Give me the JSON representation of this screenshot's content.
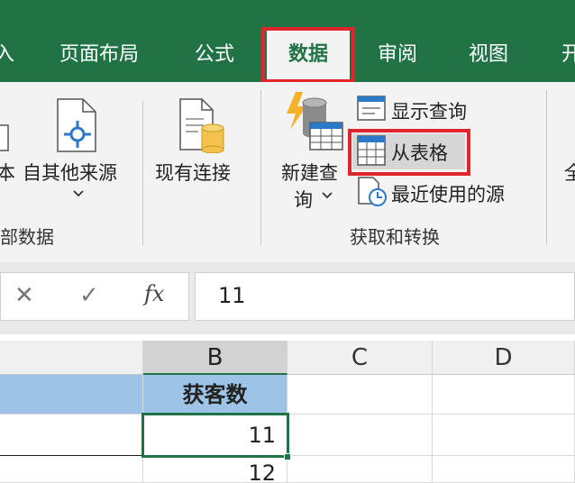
{
  "tabs": [
    {
      "label": "入"
    },
    {
      "label": "页面布局"
    },
    {
      "label": "公式"
    },
    {
      "label": "数据"
    },
    {
      "label": "审阅"
    },
    {
      "label": "视图"
    },
    {
      "label": "开"
    }
  ],
  "ribbon": {
    "external_data_group": {
      "clipped_text_label": "本",
      "from_other_sources_label": "自其他来源",
      "existing_connections_label": "现有连接",
      "group_label": "部数据"
    },
    "get_transform_group": {
      "new_query_label_line1": "新建查",
      "new_query_label_line2": "询",
      "show_queries_label": "显示查询",
      "from_table_label": "从表格",
      "recent_sources_label": "最近使用的源",
      "group_label": "获取和转换"
    },
    "clipped_next_group_label": "全"
  },
  "formula_bar": {
    "cancel_glyph": "✕",
    "enter_glyph": "✓",
    "fx_glyph": "fx",
    "value": "11"
  },
  "grid": {
    "columns": [
      "B",
      "C",
      "D"
    ],
    "selected_column": "B",
    "rows": [
      {
        "b": "获客数"
      },
      {
        "b": "11"
      },
      {
        "b": "12"
      }
    ]
  },
  "colors": {
    "accent": "#217346",
    "highlight_box": "#e0252d",
    "header_fill": "#9dc3e6"
  }
}
